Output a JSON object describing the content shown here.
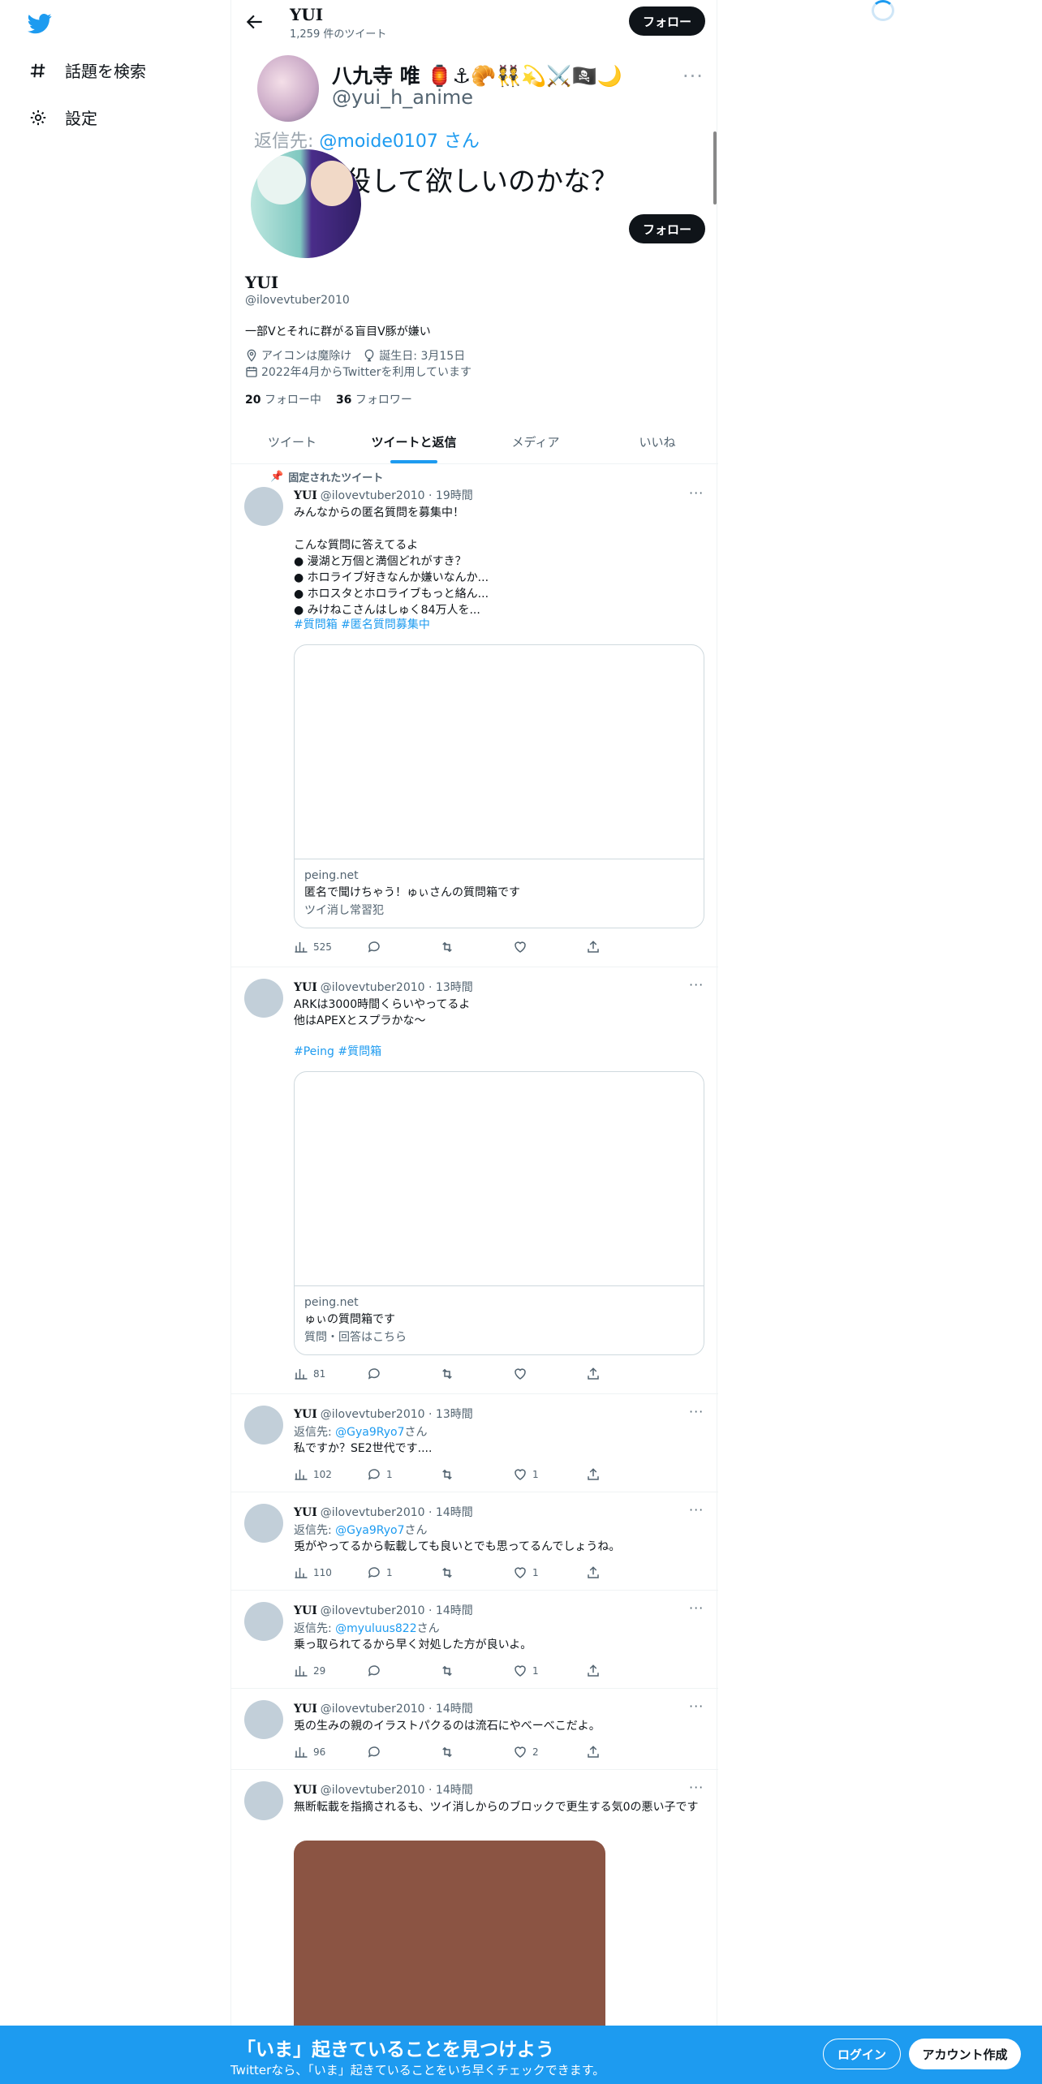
{
  "nav": {
    "items": [
      {
        "label": "話題を検索",
        "icon": "hashtag-icon"
      },
      {
        "label": "設定",
        "icon": "gear-icon"
      }
    ]
  },
  "header": {
    "title": "YUI",
    "subtitle": "1,259 件のツイート",
    "follow_label": "フォロー"
  },
  "quoted_overlay": {
    "name": "八九寺 唯 🏮⚓🥐👯💫⚔️🏴‍☠️🌙",
    "handle": "@yui_h_anime",
    "more": "···",
    "reply_prefix": "返信先: ",
    "reply_user": "@moide0107",
    "reply_suffix": " さん",
    "text": "殺して欲しいのかな？"
  },
  "profile": {
    "follow_label": "フォロー",
    "name": "YUI",
    "handle": "@ilovevtuber2010",
    "bio": "一部Vとそれに群がる盲目V豚が嫌い",
    "location": "アイコンは魔除け",
    "birthday": "誕生日: 3月15日",
    "joined": "2022年4月からTwitterを利用しています",
    "following_count": "20",
    "following_label": "フォロー中",
    "followers_count": "36",
    "followers_label": "フォロワー"
  },
  "tabs": [
    "ツイート",
    "ツイートと返信",
    "メディア",
    "いいね"
  ],
  "pinned_label": "固定されたツイート",
  "tweets": [
    {
      "name": "YUI",
      "handle": "@ilovevtuber2010",
      "time": "19時間",
      "line1": "みんなからの匿名質問を募集中！",
      "body": "こんな質問に答えてるよ\n● 漫湖と万個と満個どれがすき？\n● ホロライブ好きなんか嫌いなんか...\n● ホロスタとホロライブもっと絡ん...\n● みけねこさんはしゅく84万人を...",
      "tags": "#質問箱 #匿名質問募集中",
      "card": {
        "domain": "peing.net",
        "title": "匿名で聞けちゃう！ゅぃさんの質問箱です",
        "desc": "ツイ消し常習犯"
      },
      "views": "525",
      "replies": "",
      "likes": ""
    },
    {
      "name": "YUI",
      "handle": "@ilovevtuber2010",
      "time": "13時間",
      "body": "ARKは3000時間くらいやってるよ\n他はAPEXとスプラかな〜",
      "tags": "#Peing #質問箱",
      "card": {
        "domain": "peing.net",
        "title": "ゅぃの質問箱です",
        "desc": "質問・回答はこちら"
      },
      "views": "81",
      "replies": "",
      "likes": ""
    },
    {
      "name": "YUI",
      "handle": "@ilovevtuber2010",
      "time": "13時間",
      "reply_prefix": "返信先: ",
      "reply_user": "@Gya9Ryo7",
      "reply_suffix": "さん",
      "body": "私ですか？SE2世代です....",
      "views": "102",
      "replies": "1",
      "likes": "1"
    },
    {
      "name": "YUI",
      "handle": "@ilovevtuber2010",
      "time": "14時間",
      "reply_prefix": "返信先: ",
      "reply_user": "@Gya9Ryo7",
      "reply_suffix": "さん",
      "body": "兎がやってるから転載しても良いとでも思ってるんでしょうね。",
      "views": "110",
      "replies": "1",
      "likes": "1"
    },
    {
      "name": "YUI",
      "handle": "@ilovevtuber2010",
      "time": "14時間",
      "reply_prefix": "返信先: ",
      "reply_user": "@myuluus822",
      "reply_suffix": "さん",
      "body": "乗っ取られてるから早く対処した方が良いよ。",
      "views": "29",
      "replies": "",
      "likes": "1"
    },
    {
      "name": "YUI",
      "handle": "@ilovevtuber2010",
      "time": "14時間",
      "body": "兎の生みの親のイラストパクるのは流石にやべーべこだよ。",
      "views": "96",
      "replies": "",
      "likes": "2"
    },
    {
      "name": "YUI",
      "handle": "@ilovevtuber2010",
      "time": "14時間",
      "body": "無断転載を指摘されるも、ツイ消しからのブロックで更生する気0の悪い子です"
    }
  ],
  "banner": {
    "title": "「いま」起きていることを見つけよう",
    "subtitle": "Twitterなら、「いま」起きていることをいち早くチェックできます。",
    "login": "ログイン",
    "signup": "アカウント作成"
  },
  "colors": {
    "accent": "#1d9bf0",
    "text": "#0f1419",
    "muted": "#536471"
  }
}
